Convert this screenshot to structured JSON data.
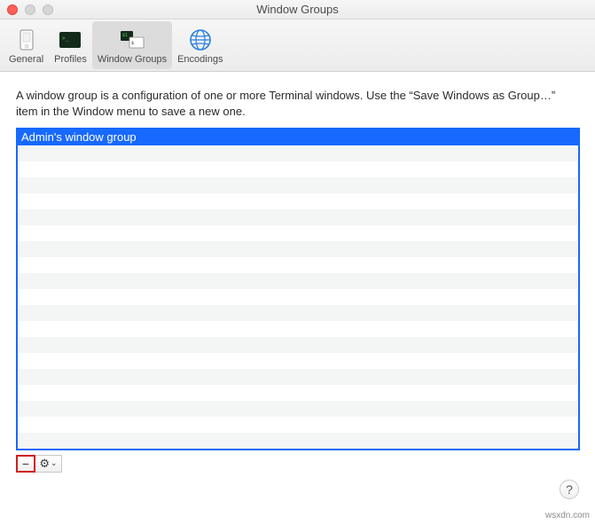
{
  "window": {
    "title": "Window Groups"
  },
  "toolbar": {
    "items": [
      {
        "label": "General"
      },
      {
        "label": "Profiles"
      },
      {
        "label": "Window Groups"
      },
      {
        "label": "Encodings"
      }
    ]
  },
  "description": "A window group is a configuration of one or more Terminal windows. Use the “Save Windows as Group…” item in the Window menu to save a new one.",
  "list": {
    "items": [
      "Admin's window group"
    ],
    "selected_index": 0,
    "visible_rows": 20
  },
  "footer": {
    "remove_symbol": "−",
    "action_symbol": "⚙",
    "dropdown_symbol": "⌄",
    "help_symbol": "?"
  },
  "watermark": "wsxdn.com"
}
